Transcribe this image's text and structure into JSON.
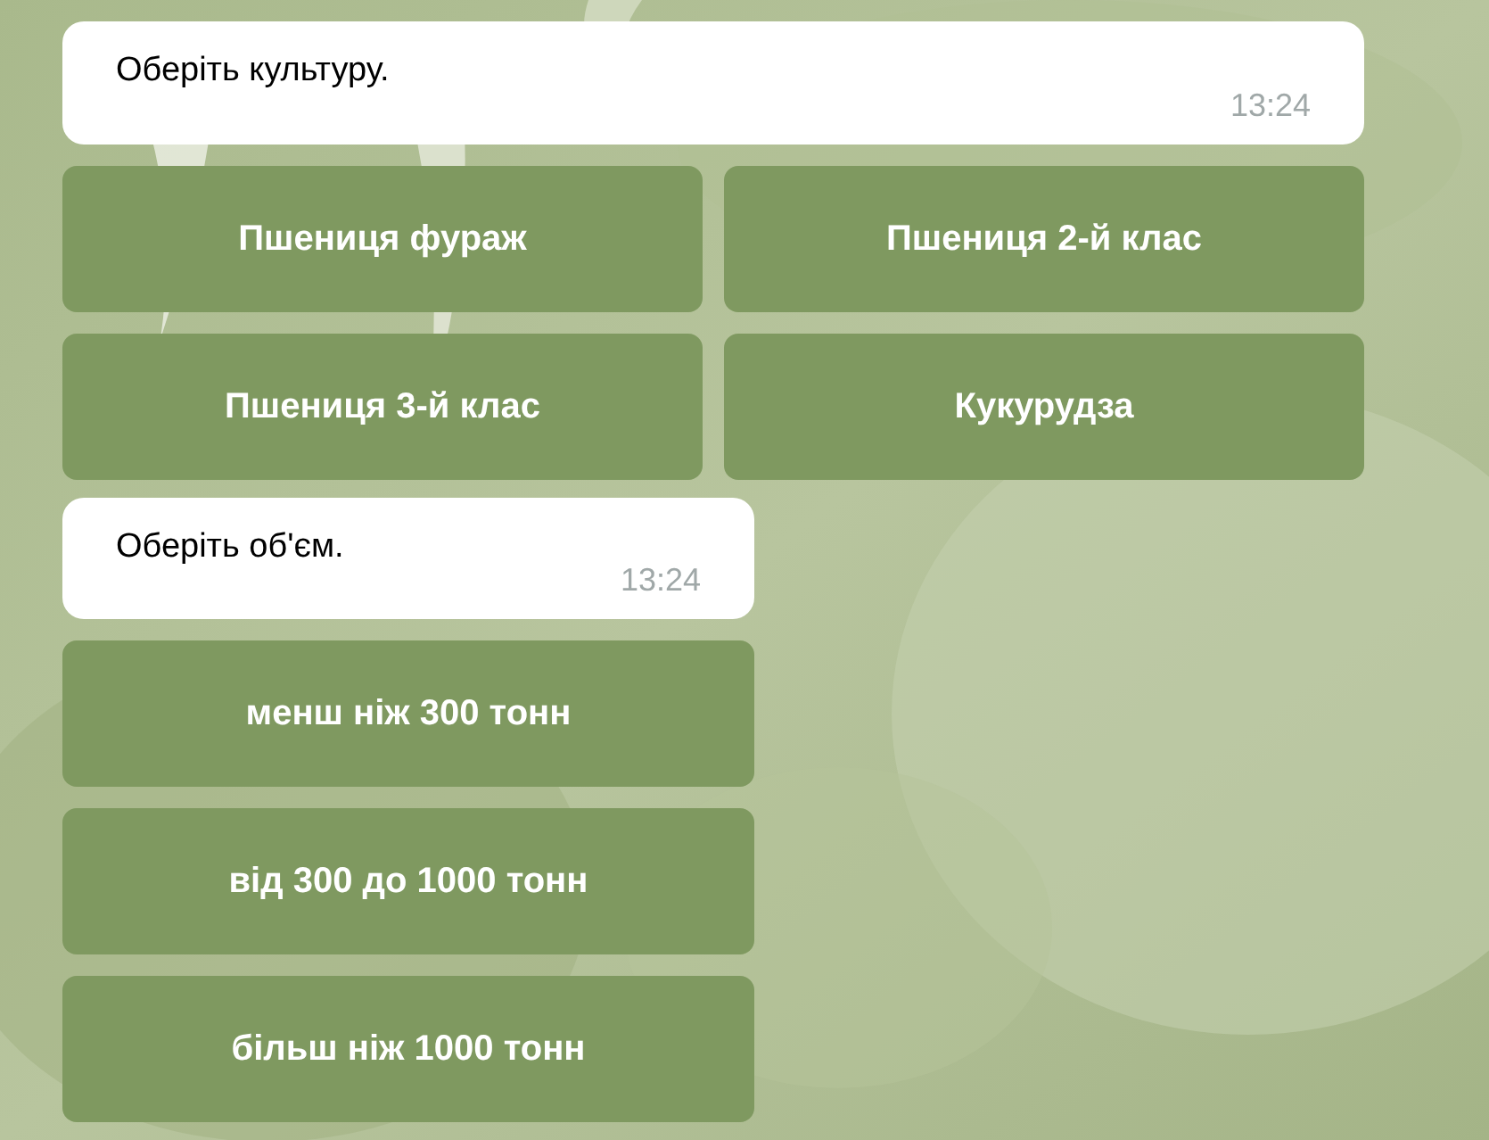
{
  "chat": [
    {
      "kind": "message",
      "text": "Оберіть культуру.",
      "time": "13:24",
      "wide": true
    },
    {
      "kind": "keyboard",
      "wide": true,
      "rows": [
        [
          "Пшениця фураж",
          "Пшениця 2-й клас"
        ],
        [
          "Пшениця 3-й клас",
          "Кукурудза"
        ]
      ]
    },
    {
      "kind": "message",
      "text": "Оберіть об'єм.",
      "time": "13:24",
      "wide": false
    },
    {
      "kind": "keyboard",
      "wide": false,
      "rows": [
        [
          "менш ніж 300 тонн"
        ],
        [
          "від 300 до 1000 тонн"
        ],
        [
          "більш ніж 1000 тонн"
        ]
      ]
    }
  ]
}
